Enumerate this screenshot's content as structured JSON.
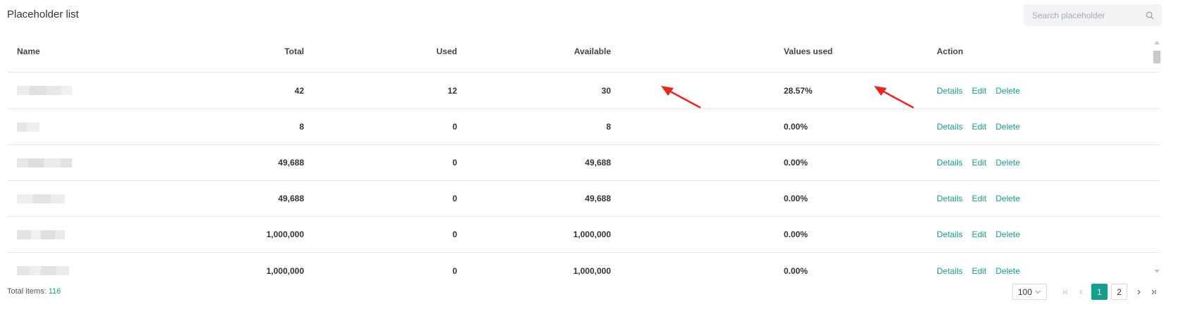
{
  "header": {
    "title": "Placeholder list",
    "search_placeholder": "Search placeholder"
  },
  "table": {
    "columns": [
      "Name",
      "Total",
      "Used",
      "Available",
      "Values used",
      "Action"
    ],
    "rows": [
      {
        "total": "42",
        "used": "12",
        "available": "30",
        "values_used": "28.57%"
      },
      {
        "total": "8",
        "used": "0",
        "available": "8",
        "values_used": "0.00%"
      },
      {
        "total": "49,688",
        "used": "0",
        "available": "49,688",
        "values_used": "0.00%"
      },
      {
        "total": "49,688",
        "used": "0",
        "available": "49,688",
        "values_used": "0.00%"
      },
      {
        "total": "1,000,000",
        "used": "0",
        "available": "1,000,000",
        "values_used": "0.00%"
      },
      {
        "total": "1,000,000",
        "used": "0",
        "available": "1,000,000",
        "values_used": "0.00%"
      }
    ],
    "actions": {
      "details": "Details",
      "edit": "Edit",
      "delete": "Delete"
    }
  },
  "footer": {
    "total_label": "Total items:",
    "total_count": "116",
    "page_size": "100",
    "pages": [
      "1",
      "2"
    ],
    "current_page": "1"
  },
  "colors": {
    "accent": "#14a08c",
    "annotation_arrow": "#e8261c"
  },
  "icons": [
    "search-icon",
    "chevron-down-icon",
    "first-page-icon",
    "prev-page-icon",
    "next-page-icon",
    "last-page-icon",
    "annotation-arrow-icon"
  ]
}
